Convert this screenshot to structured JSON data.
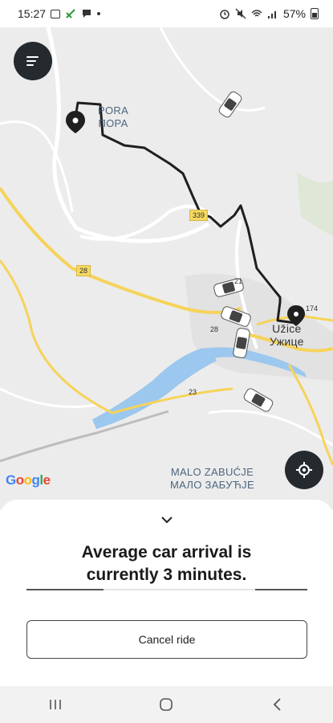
{
  "status_bar": {
    "time": "15:27",
    "battery": "57%",
    "icons_left": [
      "gallery-icon",
      "no-signal-icon",
      "message-icon",
      "dot-icon"
    ],
    "icons_right": [
      "alarm-icon",
      "mute-icon",
      "wifi-icon",
      "signal-icon",
      "battery-icon"
    ]
  },
  "map": {
    "labels": {
      "pora_latin": "PORA",
      "pora_cyrillic": "ПОРА",
      "uzice_latin": "Užice",
      "uzice_cyrillic": "Ужице",
      "malo_latin": "MALO ZABUĆJE",
      "malo_cyrillic": "МАЛО ЗАБУЋЈЕ"
    },
    "road_numbers": {
      "r339": "339",
      "r28": "28",
      "r28b": "28",
      "r23": "23",
      "r174": "174",
      "r21": "21"
    },
    "attribution": "Google",
    "colors": {
      "route": "#1f1f1f",
      "major_road": "#f6d35a",
      "water": "#9cc7ee",
      "urban": "#e3e3e3"
    }
  },
  "buttons": {
    "menu": "menu-icon",
    "locate": "locate-icon"
  },
  "sheet": {
    "collapse_icon": "chevron-down-icon",
    "arrival_line1": "Average car arrival is",
    "arrival_line2": "currently 3 minutes.",
    "cancel_label": "Cancel ride"
  },
  "nav_bar": {
    "recents": "recents-icon",
    "home": "home-icon",
    "back": "back-icon"
  }
}
